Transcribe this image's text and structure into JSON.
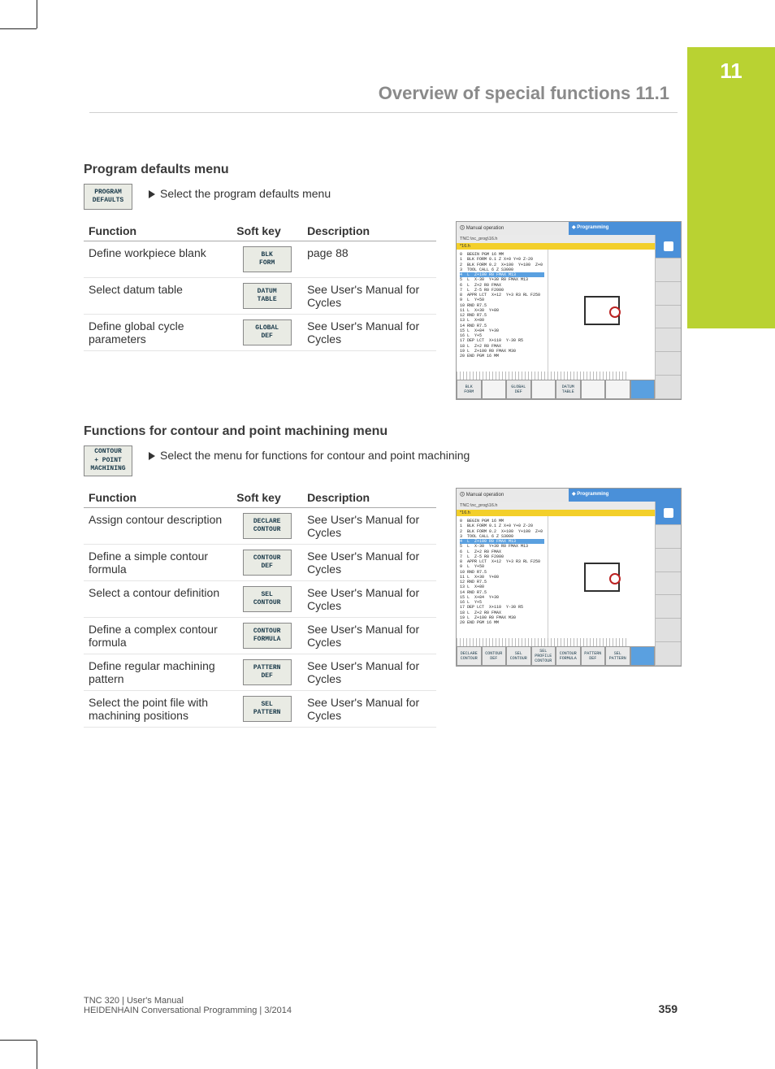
{
  "chapter_number": "11",
  "section_title": "Overview of special functions   11.1",
  "defaults": {
    "heading": "Program defaults menu",
    "softkey": "PROGRAM\nDEFAULTS",
    "bullet": "Select the program defaults menu",
    "headers": {
      "func": "Function",
      "key": "Soft key",
      "desc": "Description"
    },
    "rows": [
      {
        "func": "Define workpiece blank",
        "key": "BLK\nFORM",
        "desc": "page 88"
      },
      {
        "func": "Select datum table",
        "key": "DATUM\nTABLE",
        "desc": "See User's Manual for Cycles"
      },
      {
        "func": "Define global cycle parameters",
        "key": "GLOBAL\nDEF",
        "desc": "See User's Manual for Cycles"
      }
    ]
  },
  "contour": {
    "heading": "Functions for contour and point machining menu",
    "softkey": "CONTOUR\n+ POINT\nMACHINING",
    "bullet": "Select the menu for functions for contour and point machining",
    "headers": {
      "func": "Function",
      "key": "Soft key",
      "desc": "Description"
    },
    "rows": [
      {
        "func": "Assign contour description",
        "key": "DECLARE\nCONTOUR",
        "desc": "See User's Manual for Cycles"
      },
      {
        "func": "Define a simple contour formula",
        "key": "CONTOUR\nDEF",
        "desc": "See User's Manual for Cycles"
      },
      {
        "func": "Select a contour definition",
        "key": "SEL\nCONTOUR",
        "desc": "See User's Manual for Cycles"
      },
      {
        "func": "Define a complex contour formula",
        "key": "CONTOUR\nFORMULA",
        "desc": "See User's Manual for Cycles"
      },
      {
        "func": "Define regular machining pattern",
        "key": "PATTERN\nDEF",
        "desc": "See User's Manual for Cycles"
      },
      {
        "func": "Select the point file with machining positions",
        "key": "SEL\nPATTERN",
        "desc": "See User's Manual for Cycles"
      }
    ]
  },
  "screenshot1": {
    "title_left": "Manual operation",
    "title_right": "Programming",
    "path": "TNC:\\nc_prog\\16.h",
    "file_tab": "*16.h",
    "code": "0  BEGIN PGM 16 MM\n1  BLK FORM 0.1 Z X+0 Y+0 Z-20\n2  BLK FORM 0.2  X+100  Y+100  Z+0\n3  TOOL CALL 6 Z S3000\n4  L  Z+100 R0 FMAX M13\n5  L  X-30  Y+30 R0 FMAX M13\n6  L  Z+2 R0 FMAX\n7  L  Z-5 R0 F2000\n8  APPR LCT  X+12  Y+3 R3 RL F250\n9  L  Y+50\n10 RND R7.5\n11 L  X+30  Y+80\n12 RND R7.5\n13 L  X+80\n14 RND R7.5\n15 L  X+84  Y+30\n16 L  Y+5\n17 DEP LCT  X+110  Y-30 R5\n18 L  Z+2 R0 FMAX\n19 L  Z+100 R0 FMAX M30\n20 END PGM 16 MM",
    "hl_line": 4,
    "softkeys": [
      "BLK\nFORM",
      "",
      "GLOBAL\nDEF",
      "",
      "DATUM\nTABLE",
      "",
      "",
      ""
    ]
  },
  "screenshot2": {
    "title_left": "Manual operation",
    "title_right": "Programming",
    "path": "TNC:\\nc_prog\\16.h",
    "file_tab": "*16.h",
    "code": "0  BEGIN PGM 16 MM\n1  BLK FORM 0.1 Z X+0 Y+0 Z-20\n2  BLK FORM 0.2  X+100  Y+100  Z+0\n3  TOOL CALL 6 Z S3000\n4  L  Z+100 R0 FMAX M13\n5  L  X-30  Y+30 R0 FMAX M13\n6  L  Z+2 R0 FMAX\n7  L  Z-5 R0 F2000\n8  APPR LCT  X+12  Y+3 R3 RL F250\n9  L  Y+50\n10 RND R7.5\n11 L  X+30  Y+80\n12 RND R7.5\n13 L  X+80\n14 RND R7.5\n15 L  X+84  Y+30\n16 L  Y+5\n17 DEP LCT  X+110  Y-30 R5\n18 L  Z+2 R0 FMAX\n19 L  Z+100 R0 FMAX M30\n20 END PGM 16 MM",
    "hl_line": 4,
    "softkeys": [
      "DECLARE\nCONTOUR",
      "CONTOUR\nDEF",
      "SEL\nCONTOUR",
      "SEL\nPROFILE\nCONTOUR",
      "CONTOUR\nFORMULA",
      "PATTERN\nDEF",
      "SEL\nPATTERN",
      ""
    ]
  },
  "footer": {
    "left1": "TNC 320 | User's Manual",
    "left2": "HEIDENHAIN Conversational Programming | 3/2014",
    "page": "359"
  }
}
